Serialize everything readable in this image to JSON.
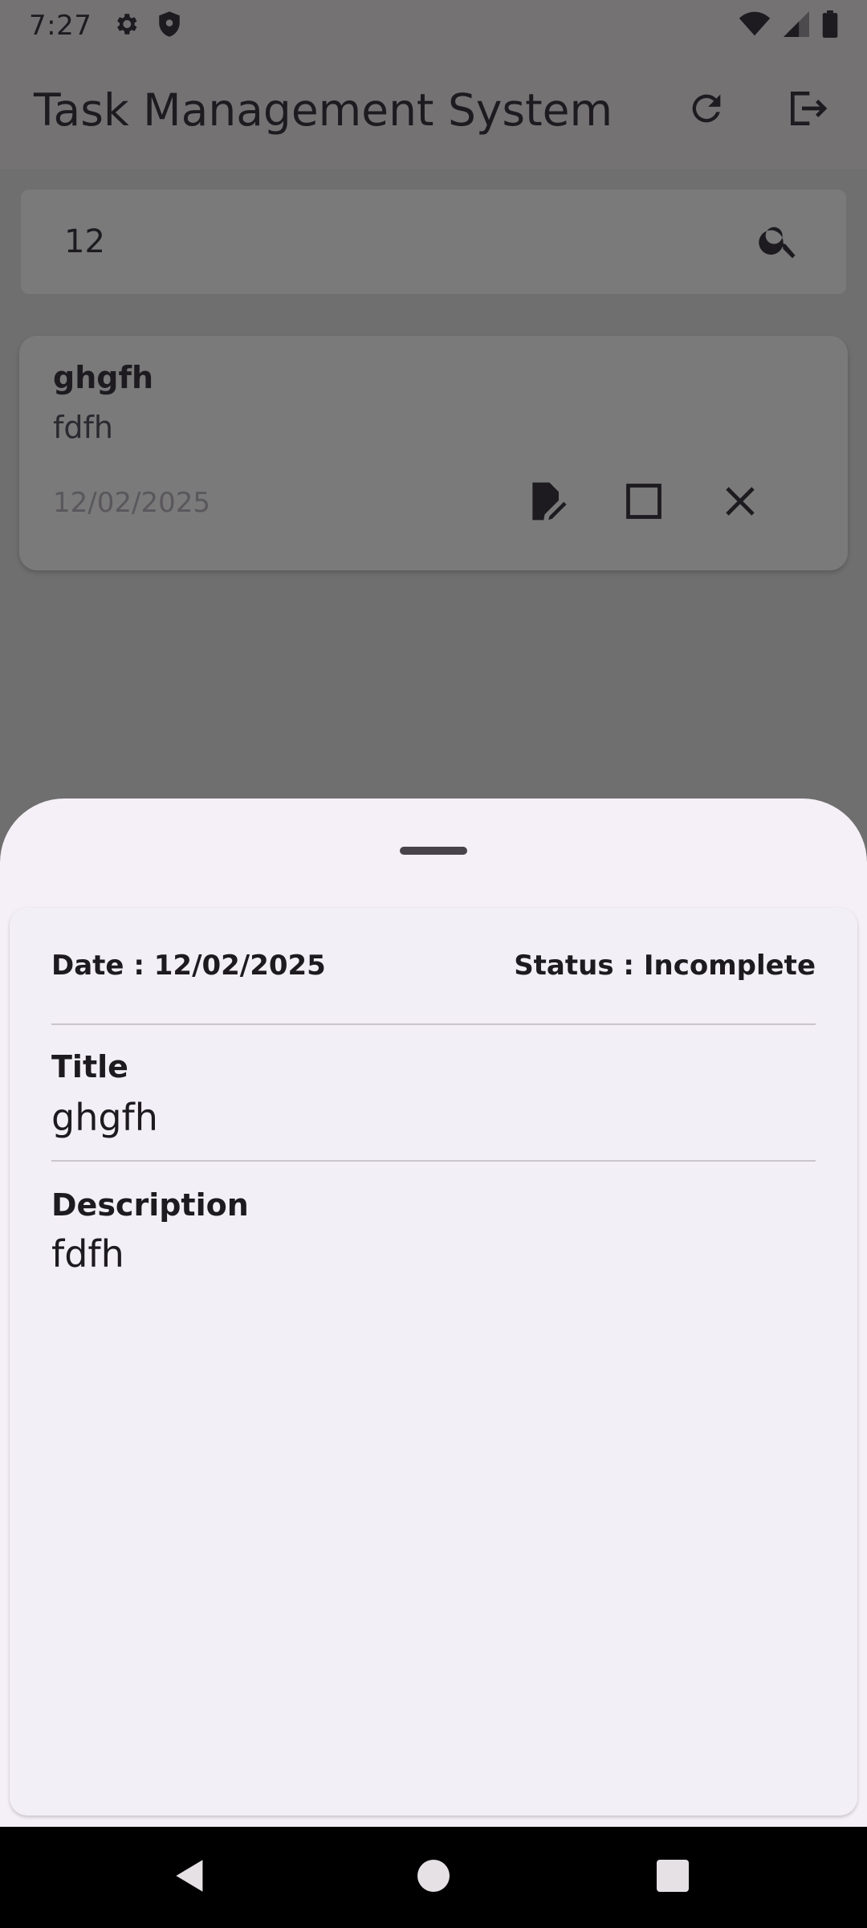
{
  "status_bar": {
    "time": "7:27",
    "icons": [
      "settings-icon",
      "shield-icon",
      "wifi-icon",
      "signal-icon",
      "battery-icon"
    ]
  },
  "app_bar": {
    "title": "Task Management System",
    "actions": [
      "refresh-icon",
      "logout-icon"
    ]
  },
  "search": {
    "value": "12",
    "icon": "search-icon"
  },
  "task_card": {
    "title": "ghgfh",
    "description": "fdfh",
    "date": "12/02/2025",
    "actions": [
      "edit-icon",
      "checkbox-icon",
      "close-icon"
    ]
  },
  "sheet": {
    "date_text": "Date : 12/02/2025",
    "status_text": "Status : Incomplete",
    "title_label": "Title",
    "title_value": "ghgfh",
    "description_label": "Description",
    "description_value": "fdfh"
  },
  "nav_bar": {
    "buttons": [
      "back-icon",
      "home-icon",
      "recents-icon"
    ]
  },
  "colors": {
    "scrim": "#6f6f6f",
    "sheet_bg": "#f5f0f7",
    "text_primary": "#1d1b20"
  }
}
